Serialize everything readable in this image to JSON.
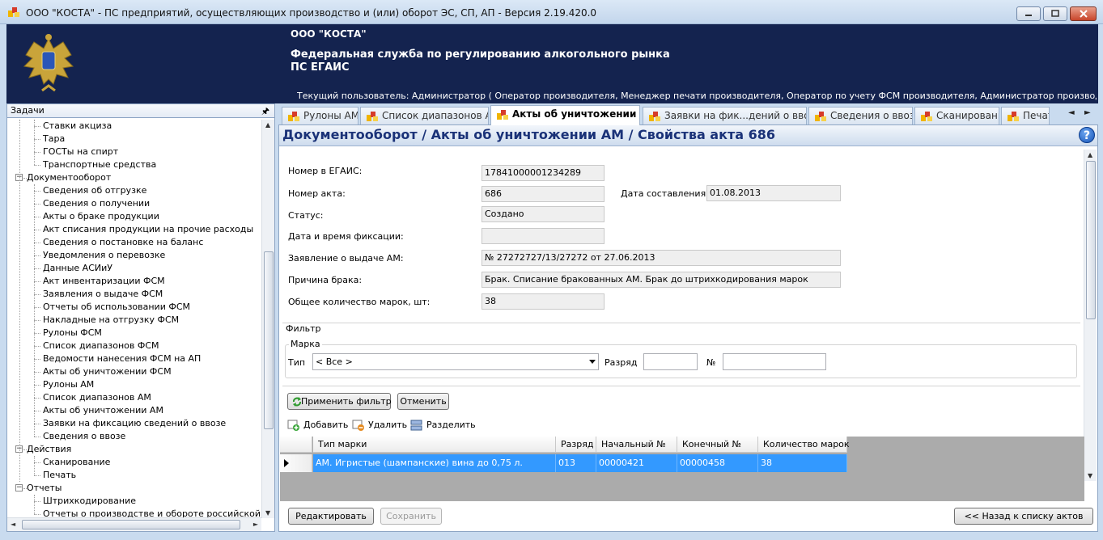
{
  "window": {
    "title": "ООО \"КОСТА\" - ПС предприятий, осуществляющих производство и (или) оборот ЭС, СП, АП - Версия 2.19.420.0"
  },
  "banner": {
    "org": "ООО \"КОСТА\"",
    "service_line1": "Федеральная служба по регулированию алкогольного рынка",
    "service_line2": "ПС ЕГАИС",
    "user": "Текущий пользователь: Администратор ( Оператор производителя, Менеджер печати производителя, Оператор по учету ФСМ производителя, Администратор производителя, Оператор печа..."
  },
  "tasks": {
    "header": "Задачи",
    "pin_glyph": "ф",
    "items": [
      {
        "type": "leaf",
        "label": "Ставки акциза"
      },
      {
        "type": "leaf",
        "label": "Тара"
      },
      {
        "type": "leaf",
        "label": "ГОСТы на спирт"
      },
      {
        "type": "leaf",
        "label": "Транспортные средства"
      },
      {
        "type": "group",
        "label": "Документооборот"
      },
      {
        "type": "leaf",
        "label": "Сведения об отгрузке"
      },
      {
        "type": "leaf",
        "label": "Сведения о получении"
      },
      {
        "type": "leaf",
        "label": "Акты о браке продукции"
      },
      {
        "type": "leaf",
        "label": "Акт списания продукции на прочие расходы"
      },
      {
        "type": "leaf",
        "label": "Сведения о постановке на баланс"
      },
      {
        "type": "leaf",
        "label": "Уведомления о перевозке"
      },
      {
        "type": "leaf",
        "label": "Данные АСИиУ"
      },
      {
        "type": "leaf",
        "label": "Акт инвентаризации ФСМ"
      },
      {
        "type": "leaf",
        "label": "Заявления о выдаче ФСМ"
      },
      {
        "type": "leaf",
        "label": "Отчеты об использовании ФСМ"
      },
      {
        "type": "leaf",
        "label": "Накладные на отгрузку ФСМ"
      },
      {
        "type": "leaf",
        "label": "Рулоны ФСМ"
      },
      {
        "type": "leaf",
        "label": "Список диапазонов ФСМ"
      },
      {
        "type": "leaf",
        "label": "Ведомости нанесения ФСМ на АП"
      },
      {
        "type": "leaf",
        "label": "Акты об уничтожении ФСМ"
      },
      {
        "type": "leaf",
        "label": "Рулоны АМ"
      },
      {
        "type": "leaf",
        "label": "Список диапазонов АМ"
      },
      {
        "type": "leaf",
        "label": "Акты об уничтожении АМ"
      },
      {
        "type": "leaf",
        "label": "Заявки на фиксацию сведений о ввозе"
      },
      {
        "type": "leaf",
        "label": "Сведения о ввозе"
      },
      {
        "type": "group",
        "label": "Действия"
      },
      {
        "type": "leaf",
        "label": "Сканирование"
      },
      {
        "type": "leaf",
        "label": "Печать"
      },
      {
        "type": "group",
        "label": "Отчеты"
      },
      {
        "type": "leaf",
        "label": "Штрихкодирование"
      },
      {
        "type": "leaf",
        "label": "Отчеты о производстве и обороте российской проду"
      }
    ]
  },
  "tabs": [
    {
      "label": "Рулоны АМ",
      "active": false
    },
    {
      "label": "Список диапазонов АМ",
      "active": false
    },
    {
      "label": "Акты об уничтожении АМ",
      "active": true
    },
    {
      "label": "Заявки на фик...дений о ввозе",
      "active": false
    },
    {
      "label": "Сведения о ввозе",
      "active": false
    },
    {
      "label": "Сканирование",
      "active": false
    },
    {
      "label": "Печать",
      "active": false
    }
  ],
  "page": {
    "title": "Документооборот / Акты об уничтожении АМ / Свойства акта 686",
    "help": "?"
  },
  "form": {
    "egais_label": "Номер в ЕГАИС:",
    "egais_value": "17841000001234289",
    "act_label": "Номер акта:",
    "act_value": "686",
    "date_label": "Дата составления:",
    "date_value": "01.08.2013",
    "status_label": "Статус:",
    "status_value": "Создано",
    "fix_label": "Дата и время фиксации:",
    "fix_value": "",
    "app_label": "Заявление о выдаче АМ:",
    "app_value": "№ 27272727/13/27272 от 27.06.2013",
    "reason_label": "Причина брака:",
    "reason_value": "Брак. Списание бракованных АМ. Брак до штрихкодирования марок",
    "total_label": "Общее количество марок, шт:",
    "total_value": "38"
  },
  "filter": {
    "title": "Фильтр",
    "mark_title": "Марка",
    "type_label": "Тип",
    "type_value": "< Все >",
    "rank_label": "Разряд",
    "rank_value": "",
    "num_label": "№",
    "num_value": "",
    "apply": "Применить фильтр",
    "cancel": "Отменить"
  },
  "toolbar": {
    "add": "Добавить",
    "delete": "Удалить",
    "split": "Разделить"
  },
  "grid": {
    "columns": [
      "Тип марки",
      "Разряд",
      "Начальный №",
      "Конечный №",
      "Количество марок"
    ],
    "rows": [
      [
        "АМ. Игристые (шампанские) вина до 0,75 л.",
        "013",
        "00000421",
        "00000458",
        "38"
      ]
    ]
  },
  "footer": {
    "edit": "Редактировать",
    "save": "Сохранить",
    "back": "<< Назад к списку актов"
  },
  "colors": {
    "banner_bg": "#14234f",
    "selected_row": "#3399ff",
    "page_title": "#1a3278"
  }
}
